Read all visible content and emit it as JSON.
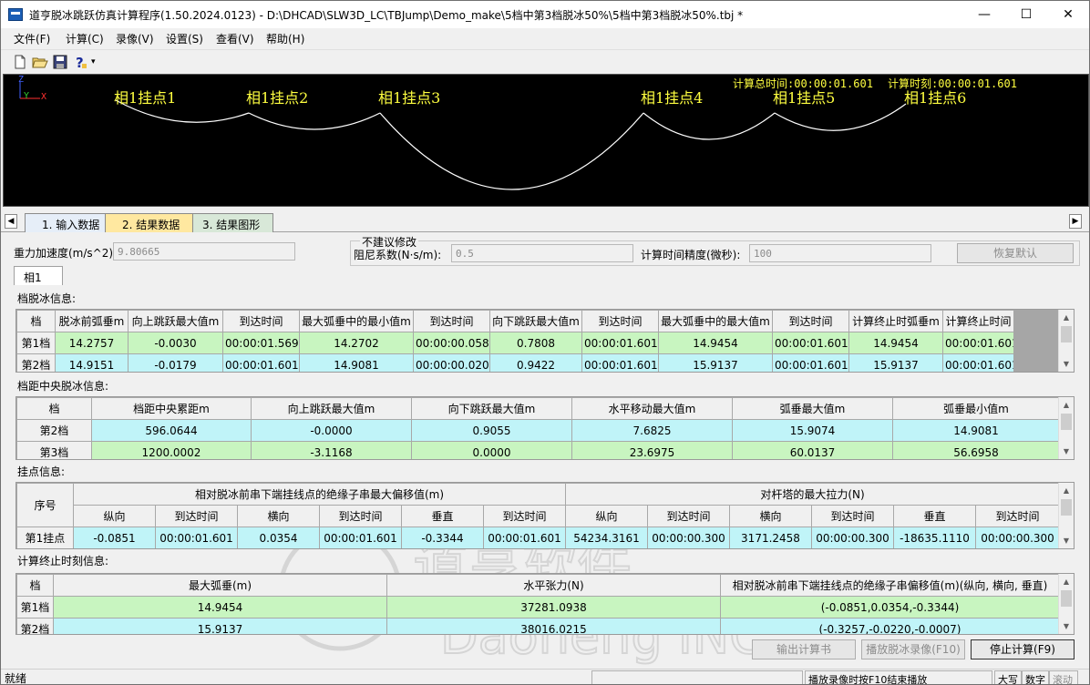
{
  "window": {
    "title": "道亨脱冰跳跃仿真计算程序(1.50.2024.0123) - D:\\DHCAD\\SLW3D_LC\\TBJump\\Demo_make\\5档中第3档脱冰50%\\5档中第3档脱冰50%.tbj *",
    "min_glyph": "—",
    "max_glyph": "☐",
    "close_glyph": "✕"
  },
  "menu": [
    "文件(F)",
    "计算(C)",
    "录像(V)",
    "设置(S)",
    "查看(V)",
    "帮助(H)"
  ],
  "toolbar": {
    "icons": [
      "new-file-icon",
      "open-folder-icon",
      "save-icon",
      "help-icon"
    ],
    "drop_glyph": "▾"
  },
  "viewport": {
    "total_time": "计算总时间:00:00:01.601",
    "current_time": "计算时刻:00:00:01.601",
    "axis_z": "Z",
    "axis_y": "Y",
    "axis_x": "X",
    "nodes": [
      "相1挂点1",
      "相1挂点2",
      "相1挂点3",
      "相1挂点4",
      "相1挂点5",
      "相1挂点6"
    ],
    "colors": {
      "background": "#000000",
      "text": "#ffff40",
      "curve": "#ffffff"
    }
  },
  "tabs": [
    "1. 输入数据",
    "2. 结果数据",
    "3. 结果图形"
  ],
  "params": {
    "gravity_label": "重力加速度(m/s^2)",
    "gravity_value": "9.80665",
    "group_title": "不建议修改",
    "damping_label": "阻尼系数(N·s/m):",
    "damping_value": "0.5",
    "precision_label": "计算时间精度(微秒):",
    "precision_value": "100",
    "restore_button": "恢复默认"
  },
  "phase_tab": "相1",
  "span_ice": {
    "title": "档脱冰信息:",
    "headers": [
      "档",
      "脱冰前弧垂m",
      "向上跳跃最大值m",
      "到达时间",
      "最大弧垂中的最小值m",
      "到达时间",
      "向下跳跃最大值m",
      "到达时间",
      "最大弧垂中的最大值m",
      "到达时间",
      "计算终止时弧垂m",
      "计算终止时间"
    ],
    "rows": [
      [
        "第1档",
        "14.2757",
        "-0.0030",
        "00:00:01.569",
        "14.2702",
        "00:00:00.058",
        "0.7808",
        "00:00:01.601",
        "14.9454",
        "00:00:01.601",
        "14.9454",
        "00:00:01.601"
      ],
      [
        "第2档",
        "14.9151",
        "-0.0179",
        "00:00:01.601",
        "14.9081",
        "00:00:00.020",
        "0.9422",
        "00:00:01.601",
        "15.9137",
        "00:00:01.601",
        "15.9137",
        "00:00:01.601"
      ]
    ]
  },
  "center_ice": {
    "title": "档距中央脱冰信息:",
    "headers": [
      "档",
      "档距中央累距m",
      "向上跳跃最大值m",
      "向下跳跃最大值m",
      "水平移动最大值m",
      "弧垂最大值m",
      "弧垂最小值m"
    ],
    "rows": [
      [
        "第2档",
        "596.0644",
        "-0.0000",
        "0.9055",
        "7.6825",
        "15.9074",
        "14.9081"
      ],
      [
        "第3档",
        "1200.0002",
        "-3.1168",
        "0.0000",
        "23.6975",
        "60.0137",
        "56.6958"
      ]
    ]
  },
  "attach": {
    "title": "挂点信息:",
    "group1": "相对脱冰前串下端挂线点的绝缘子串最大偏移值(m)",
    "group2": "对杆塔的最大拉力(N)",
    "index_header": "序号",
    "subheaders": [
      "纵向",
      "到达时间",
      "横向",
      "到达时间",
      "垂直",
      "到达时间",
      "纵向",
      "到达时间",
      "横向",
      "到达时间",
      "垂直",
      "到达时间"
    ],
    "rows": [
      [
        "第1挂点",
        "-0.0851",
        "00:00:01.601",
        "0.0354",
        "00:00:01.601",
        "-0.3344",
        "00:00:01.601",
        "54234.3161",
        "00:00:00.300",
        "3171.2458",
        "00:00:00.300",
        "-18635.1110",
        "00:00:00.300"
      ]
    ]
  },
  "end_info": {
    "title": "计算终止时刻信息:",
    "headers": [
      "档",
      "最大弧垂(m)",
      "水平张力(N)",
      "相对脱冰前串下端挂线点的绝缘子串偏移值(m)(纵向, 横向, 垂直)"
    ],
    "rows": [
      [
        "第1档",
        "14.9454",
        "37281.0938",
        "(-0.0851,0.0354,-0.3344)"
      ],
      [
        "第2档",
        "15.9137",
        "38016.0215",
        "(-0.3257,-0.0220,-0.0007)"
      ]
    ]
  },
  "buttons": {
    "export": "输出计算书",
    "play": "播放脱冰录像(F10)",
    "stop": "停止计算(F9)"
  },
  "status": {
    "ready": "就绪",
    "hint": "播放录像时按F10结束播放",
    "caps": "大写",
    "num": "数字",
    "scroll": "滚动"
  },
  "watermark": {
    "cn": "道亨软件",
    "en": "Daoheng INC"
  }
}
